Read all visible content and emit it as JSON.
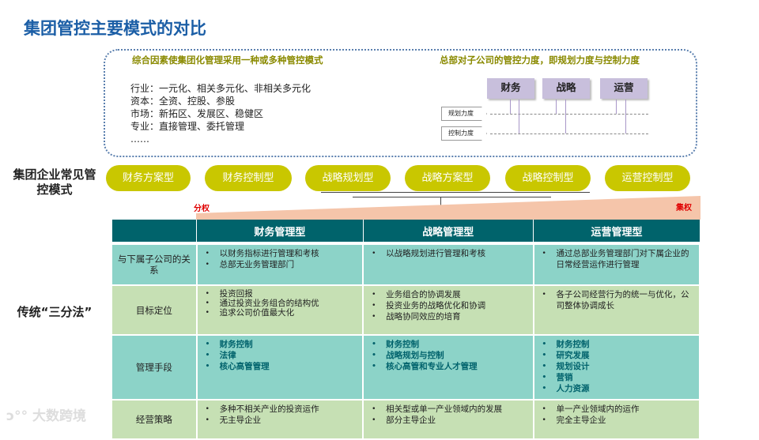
{
  "title": "集团管控主要模式的对比",
  "box": {
    "left_heading": "综合因素使集团化管理采用一种或多种管控模式",
    "right_heading": "总部对子公司的管控力度，即规划力度与控制力度",
    "factors": [
      "行业：一元化、相关多元化、非相关多元化",
      "资本：全资、控股、参股",
      "市场：新拓区、发展区、稳健区",
      "专业：直接管理、委托管理",
      "……"
    ],
    "tags": [
      "财务",
      "战略",
      "运营"
    ],
    "measures": [
      "规划力度",
      "控制力度"
    ]
  },
  "modes_label": "集团企业常见管控模式",
  "modes": [
    "财务方案型",
    "财务控制型",
    "战略规划型",
    "战略方案型",
    "战略控制型",
    "运营控制型"
  ],
  "scale": {
    "low": "分权",
    "high": "集权"
  },
  "three_label": "传统“三分法”",
  "table": {
    "headers": [
      "",
      "财务管理型",
      "战略管理型",
      "运营管理型"
    ],
    "rows": [
      {
        "label": "与下属子公司的关系",
        "cells": [
          [
            "以财务指标进行管理和考核",
            "总部无业务管理部门"
          ],
          [
            "以战略规划进行管理和考核"
          ],
          [
            "通过总部业务管理部门对下属企业的日常经营运作进行管理"
          ]
        ]
      },
      {
        "label": "目标定位",
        "cells": [
          [
            "投资回报",
            "通过投资业务组合的结构优",
            "追求公司价值最大化"
          ],
          [
            "业务组合的协调发展",
            "投资业务的战略优化和协调",
            "战略协同效应的培育"
          ],
          [
            "各子公司经营行为的统一与优化，公司整体协调成长"
          ]
        ]
      },
      {
        "label": "管理手段",
        "cells": [
          [
            "财务控制",
            "法律",
            "核心高管管理"
          ],
          [
            "财务控制",
            "战略规划与控制",
            "核心高管和专业人才管理"
          ],
          [
            "财务控制",
            "研究发展",
            "规划设计",
            "营销",
            "人力资源"
          ]
        ]
      },
      {
        "label": "经营策略",
        "cells": [
          [
            "多种不相关产业的投资运作",
            "无主导企业"
          ],
          [
            "相关型或单一产业领域内的发展",
            "部分主导企业"
          ],
          [
            "单一产业领域内的运作",
            "完全主导企业"
          ]
        ]
      }
    ]
  },
  "watermark": "大数跨境",
  "colors": {
    "title": "#1b5ea6",
    "pill": "#c9c700",
    "header": "#00636b",
    "teal_row": "#8cd3c8",
    "green_row": "#c6e0b4"
  }
}
